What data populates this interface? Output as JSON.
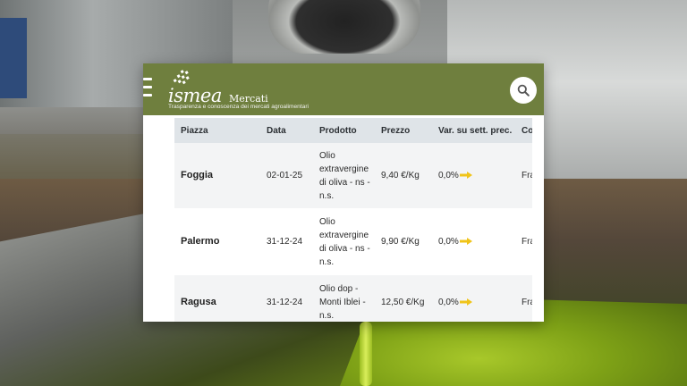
{
  "app": {
    "logo_word": "ismea",
    "logo_sub": "Mercati",
    "tagline": "Trasparenza e conoscenza dei mercati agroalimentari",
    "header_color": "#6f7f3e",
    "icons": {
      "menu": "hamburger-menu-icon",
      "search": "search-icon",
      "trend": "right-arrow-icon"
    }
  },
  "table": {
    "headers": [
      "Piazza",
      "Data",
      "Prodotto",
      "Prezzo",
      "Var. su sett. prec.",
      "Co"
    ],
    "rows": [
      {
        "piazza": "Foggia",
        "data": "02-01-25",
        "prodotto": "Olio extravergine di oliva - ns - n.s.",
        "prezzo": "9,40 €/Kg",
        "variazione": "0,0%",
        "extra": "Fra"
      },
      {
        "piazza": "Palermo",
        "data": "31-12-24",
        "prodotto": "Olio extravergine di oliva - ns - n.s.",
        "prezzo": "9,90 €/Kg",
        "variazione": "0,0%",
        "extra": "Fra"
      },
      {
        "piazza": "Ragusa",
        "data": "31-12-24",
        "prodotto": "Olio dop - Monti Iblei - n.s.",
        "prezzo": "12,50 €/Kg",
        "variazione": "0,0%",
        "extra": "Fra"
      }
    ],
    "arrow_color": "#f0c419"
  }
}
